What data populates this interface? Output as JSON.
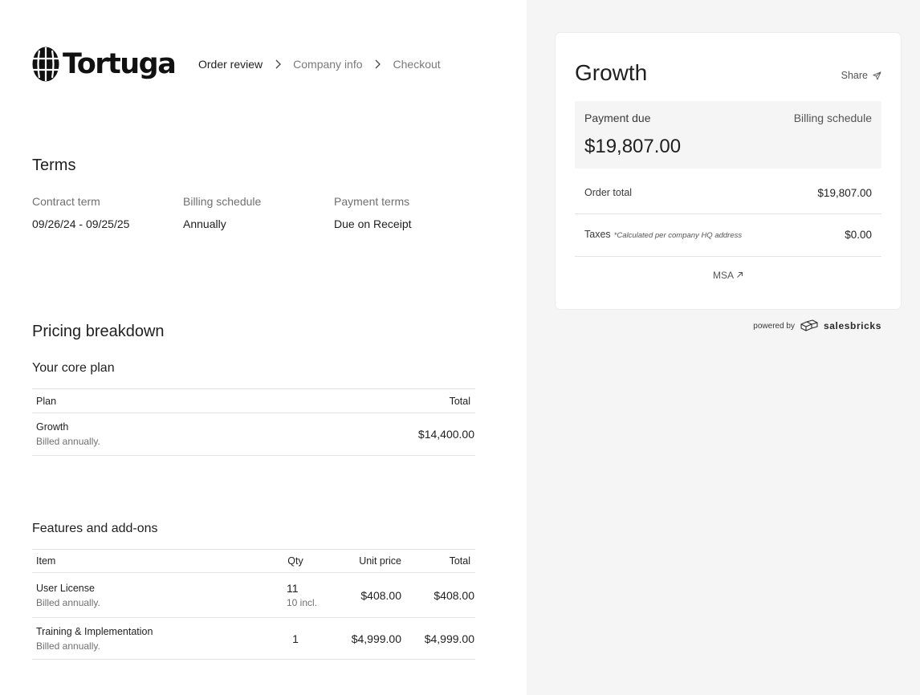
{
  "brand": {
    "name": "Tortuga"
  },
  "steps": [
    "Order review",
    "Company info",
    "Checkout"
  ],
  "terms": {
    "title": "Terms",
    "items": [
      {
        "label": "Contract term",
        "value": "09/26/24 - 09/25/25"
      },
      {
        "label": "Billing schedule",
        "value": "Annually"
      },
      {
        "label": "Payment terms",
        "value": "Due on Receipt"
      }
    ]
  },
  "pricing": {
    "title": "Pricing breakdown",
    "core": {
      "title": "Your core plan",
      "headers": {
        "plan": "Plan",
        "total": "Total"
      },
      "row": {
        "name": "Growth",
        "sub": "Billed annually.",
        "total": "$14,400.00"
      }
    },
    "addons": {
      "title": "Features and add-ons",
      "headers": {
        "item": "Item",
        "qty": "Qty",
        "unit": "Unit price",
        "total": "Total"
      },
      "rows": [
        {
          "name": "User License",
          "sub": "Billed annually.",
          "qty": "11",
          "qty_sub": "10 incl.",
          "unit": "$408.00",
          "total": "$408.00"
        },
        {
          "name": "Training & Implementation",
          "sub": "Billed annually.",
          "qty": "1",
          "qty_sub": "",
          "unit": "$4,999.00",
          "total": "$4,999.00"
        }
      ]
    }
  },
  "summary": {
    "title": "Growth",
    "share": "Share",
    "payment_due_label": "Payment due",
    "billing_schedule_label": "Billing schedule",
    "payment_due": "$19,807.00",
    "order_total_label": "Order total",
    "order_total": "$19,807.00",
    "taxes_label": "Taxes",
    "taxes_note": "*Calculated per company HQ address",
    "taxes": "$0.00",
    "msa": "MSA"
  },
  "footer": {
    "powered_by": "powered by",
    "brand": "salesbricks"
  }
}
